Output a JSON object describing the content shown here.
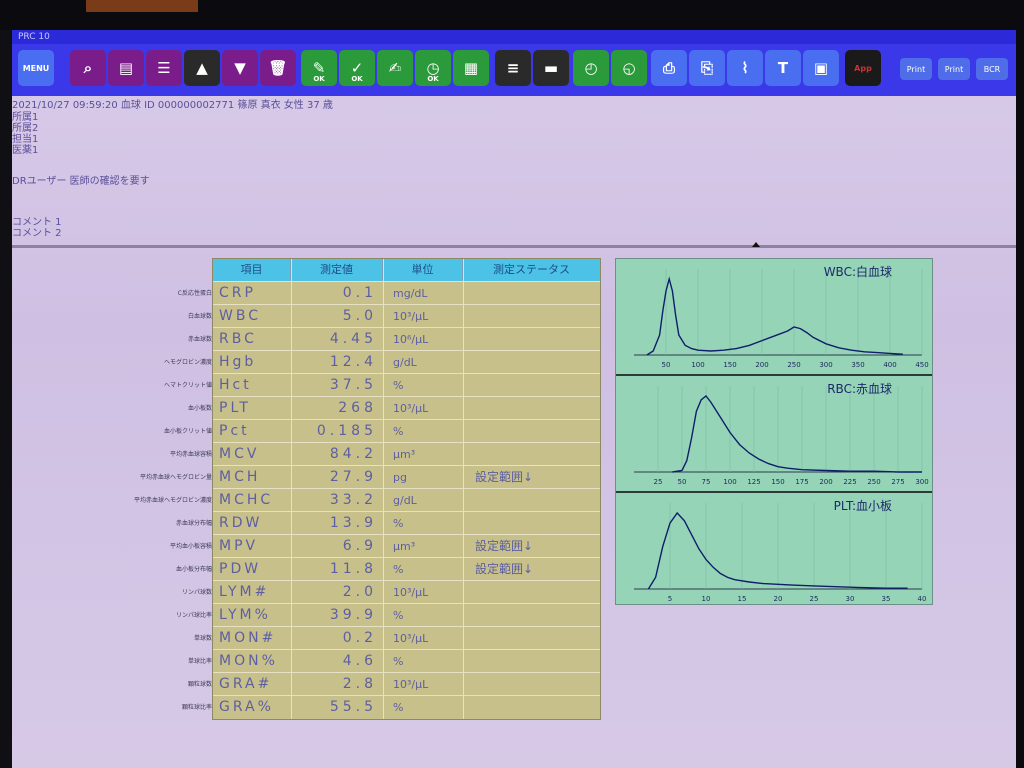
{
  "window": {
    "title": "PRC 10"
  },
  "colors": {
    "toolbar": "#3a38e8",
    "table_bg": "#c8c08a",
    "table_header": "#4cc3e6",
    "hist_bg": "#96d4b8",
    "text": "#5d5fa2"
  },
  "toolbar": {
    "menu_label": "MENU",
    "buttons": [
      {
        "icon": "menu-icon",
        "label": ""
      },
      {
        "icon": "magnifier-icon",
        "label": ""
      },
      {
        "icon": "monitor-icon",
        "label": ""
      },
      {
        "icon": "list-icon",
        "label": ""
      },
      {
        "icon": "arrow-up-icon",
        "label": ""
      },
      {
        "icon": "arrow-down-icon",
        "label": ""
      },
      {
        "icon": "trash-icon",
        "label": ""
      },
      {
        "icon": "pen-ok-icon",
        "label": "OK"
      },
      {
        "icon": "check-ok-icon",
        "label": "OK"
      },
      {
        "icon": "edit-icon",
        "label": ""
      },
      {
        "icon": "clock-ok-icon",
        "label": "OK"
      },
      {
        "icon": "grid-plus-icon",
        "label": ""
      },
      {
        "icon": "table-icon",
        "label": ""
      },
      {
        "icon": "film-icon",
        "label": ""
      },
      {
        "icon": "clock-icon",
        "label": ""
      },
      {
        "icon": "clock-add-icon",
        "label": ""
      },
      {
        "icon": "printer-icon",
        "label": ""
      },
      {
        "icon": "printer-network-icon",
        "label": ""
      },
      {
        "icon": "paperclip-icon",
        "label": ""
      },
      {
        "icon": "text-icon",
        "label": "T"
      },
      {
        "icon": "screen-icon",
        "label": ""
      },
      {
        "icon": "app-icon",
        "label": "App"
      }
    ],
    "right_buttons": [
      "Print",
      "Print",
      "BCR"
    ]
  },
  "patient": {
    "header_line": "2021/10/27 09:59:20   血球 ID   000000002771   篠原 真衣  女性  37 歳",
    "field1": "所属1",
    "field2": "所属2",
    "field3": "担当1",
    "field4": "医薬1",
    "message": "DRユーザー 医師の確認を要す",
    "comment1": "コメント 1",
    "comment2": "コメント 2"
  },
  "table": {
    "headers": [
      "項目",
      "測定値",
      "単位",
      "測定ステータス"
    ],
    "rows": [
      {
        "name": "CRP",
        "value": "0.1",
        "unit": "mg/dL",
        "status": "",
        "label": "C反応性蛋白"
      },
      {
        "name": "WBC",
        "value": "5.0",
        "unit": "10³/μL",
        "status": "",
        "label": "白血球数"
      },
      {
        "name": "RBC",
        "value": "4.45",
        "unit": "10⁶/μL",
        "status": "",
        "label": "赤血球数"
      },
      {
        "name": "Hgb",
        "value": "12.4",
        "unit": "g/dL",
        "status": "",
        "label": "ヘモグロビン濃度"
      },
      {
        "name": "Hct",
        "value": "37.5",
        "unit": "%",
        "status": "",
        "label": "ヘマトクリット値"
      },
      {
        "name": "PLT",
        "value": "268",
        "unit": "10³/μL",
        "status": "",
        "label": "血小板数"
      },
      {
        "name": "Pct",
        "value": "0.185",
        "unit": "%",
        "status": "",
        "label": "血小板クリット値"
      },
      {
        "name": "MCV",
        "value": "84.2",
        "unit": "μm³",
        "status": "",
        "label": "平均赤血球容積"
      },
      {
        "name": "MCH",
        "value": "27.9",
        "unit": "pg",
        "status": "設定範囲↓",
        "label": "平均赤血球ヘモグロビン量"
      },
      {
        "name": "MCHC",
        "value": "33.2",
        "unit": "g/dL",
        "status": "",
        "label": "平均赤血球ヘモグロビン濃度"
      },
      {
        "name": "RDW",
        "value": "13.9",
        "unit": "%",
        "status": "",
        "label": "赤血球分布幅"
      },
      {
        "name": "MPV",
        "value": "6.9",
        "unit": "μm³",
        "status": "設定範囲↓",
        "label": "平均血小板容積"
      },
      {
        "name": "PDW",
        "value": "11.8",
        "unit": "%",
        "status": "設定範囲↓",
        "label": "血小板分布幅"
      },
      {
        "name": "LYM#",
        "value": "2.0",
        "unit": "10³/μL",
        "status": "",
        "label": "リンパ球数"
      },
      {
        "name": "LYM%",
        "value": "39.9",
        "unit": "%",
        "status": "",
        "label": "リンパ球比率"
      },
      {
        "name": "MON#",
        "value": "0.2",
        "unit": "10³/μL",
        "status": "",
        "label": "単球数"
      },
      {
        "name": "MON%",
        "value": "4.6",
        "unit": "%",
        "status": "",
        "label": "単球比率"
      },
      {
        "name": "GRA#",
        "value": "2.8",
        "unit": "10³/μL",
        "status": "",
        "label": "顆粒球数"
      },
      {
        "name": "GRA%",
        "value": "55.5",
        "unit": "%",
        "status": "",
        "label": "顆粒球比率"
      }
    ]
  },
  "histograms": [
    {
      "title": "WBC:白血球",
      "ticks": [
        "50",
        "100",
        "150",
        "200",
        "250",
        "300",
        "350",
        "400",
        "450"
      ],
      "x": [
        20,
        30,
        40,
        45,
        50,
        55,
        60,
        65,
        70,
        80,
        90,
        100,
        120,
        140,
        160,
        180,
        200,
        220,
        240,
        250,
        260,
        270,
        280,
        300,
        320,
        340,
        360,
        380,
        400,
        420
      ],
      "y": [
        0,
        5,
        25,
        55,
        80,
        95,
        80,
        50,
        25,
        12,
        8,
        6,
        5,
        6,
        8,
        12,
        18,
        24,
        30,
        35,
        33,
        28,
        22,
        14,
        9,
        6,
        4,
        3,
        2,
        1
      ]
    },
    {
      "title": "RBC:赤血球",
      "ticks": [
        "25",
        "50",
        "75",
        "100",
        "125",
        "150",
        "175",
        "200",
        "225",
        "250",
        "275",
        "300"
      ],
      "x": [
        40,
        50,
        55,
        60,
        65,
        70,
        75,
        80,
        90,
        100,
        110,
        120,
        130,
        140,
        150,
        160,
        175,
        200,
        225,
        250,
        275,
        300
      ],
      "y": [
        0,
        2,
        15,
        45,
        80,
        95,
        100,
        92,
        72,
        52,
        36,
        25,
        17,
        11,
        7,
        5,
        3,
        2,
        1,
        1,
        0,
        0
      ]
    },
    {
      "title": "PLT:血小板",
      "ticks": [
        "5",
        "10",
        "15",
        "20",
        "25",
        "30",
        "35",
        "40"
      ],
      "x": [
        2,
        3,
        4,
        5,
        6,
        7,
        8,
        9,
        10,
        11,
        12,
        13,
        14,
        16,
        18,
        20,
        22,
        25,
        28,
        31,
        35,
        38
      ],
      "y": [
        0,
        15,
        55,
        85,
        98,
        88,
        70,
        52,
        38,
        28,
        20,
        15,
        12,
        9,
        7,
        6,
        5,
        4,
        3,
        2,
        1,
        1
      ]
    }
  ]
}
